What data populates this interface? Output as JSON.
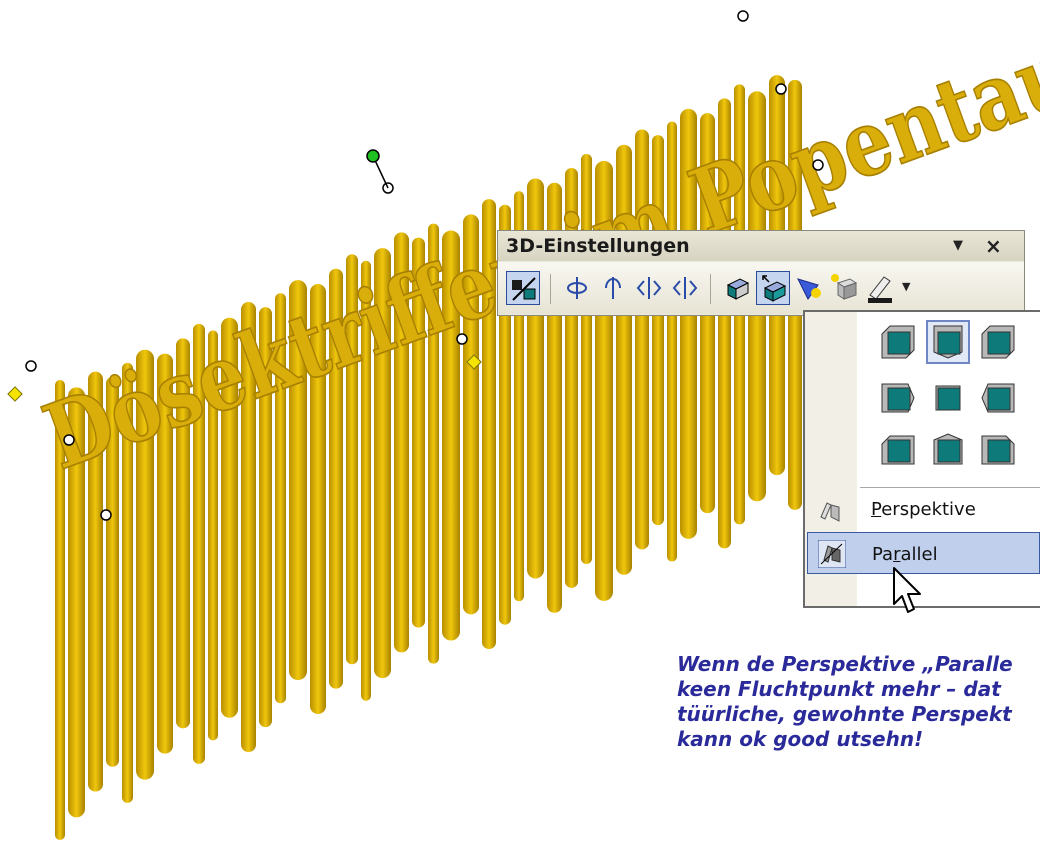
{
  "wordart": {
    "text": "Dösektriffen im Popentausend"
  },
  "toolbar": {
    "title": "3D-Einstellungen",
    "menu_icon": "dropdown-triangle-icon",
    "close_icon": "close-icon",
    "buttons": [
      {
        "name": "3d-on-off",
        "icon": "3d-toggle-icon",
        "active": true
      },
      {
        "name": "tilt-down",
        "icon": "tilt-down-icon"
      },
      {
        "name": "tilt-up",
        "icon": "tilt-up-icon"
      },
      {
        "name": "tilt-left",
        "icon": "tilt-left-icon"
      },
      {
        "name": "tilt-right",
        "icon": "tilt-right-icon"
      },
      {
        "name": "depth",
        "icon": "depth-icon"
      },
      {
        "name": "direction",
        "icon": "direction-icon",
        "active": true
      },
      {
        "name": "lighting",
        "icon": "lighting-icon"
      },
      {
        "name": "surface",
        "icon": "surface-icon"
      },
      {
        "name": "3d-color",
        "icon": "3d-color-icon"
      }
    ]
  },
  "direction_menu": {
    "selected_index": 1,
    "options": [
      {
        "label": "Perspektive",
        "accelerator": "P",
        "rest": "erspektive",
        "icon": "perspective-icon"
      },
      {
        "label": "Parallel",
        "accelerator": "r",
        "prefix": "Pa",
        "rest": "allel",
        "icon": "parallel-icon",
        "highlighted": true
      }
    ]
  },
  "caption": {
    "lines": [
      "Wenn de Perspektive „Paralle",
      "keen Fluchtpunkt mehr – dat",
      "tüürliche, gewohnte Perspekt",
      "kann ok good utsehn!"
    ]
  },
  "colors": {
    "wordart_front": "#d4a800",
    "wordart_side": "#a88200",
    "accent_teal": "#0f7a7a",
    "caption": "#2a2a9a",
    "selection": "#c0d0ec"
  }
}
